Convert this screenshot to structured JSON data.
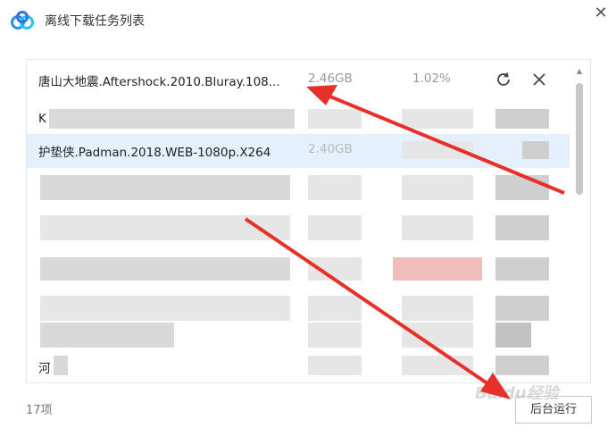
{
  "window": {
    "title": "离线下载任务列表"
  },
  "tasks": {
    "row1": {
      "name": "唐山大地震.Aftershock.2010.Bluray.108...",
      "size": "2.46GB",
      "percent": "1.02%"
    },
    "row2": {
      "name": "K"
    },
    "row3": {
      "name": "护垫侠.Padman.2018.WEB-1080p.X264",
      "size": "2.40GB"
    },
    "row9": {
      "name": "河"
    }
  },
  "footer": {
    "count": "17项",
    "background_button": "后台运行"
  },
  "watermark": {
    "text": "Baidu经验"
  },
  "colors": {
    "selected_row": "#e4f0fb",
    "arrow": "#e8302a",
    "logo_blue": "#2b8ee8"
  }
}
